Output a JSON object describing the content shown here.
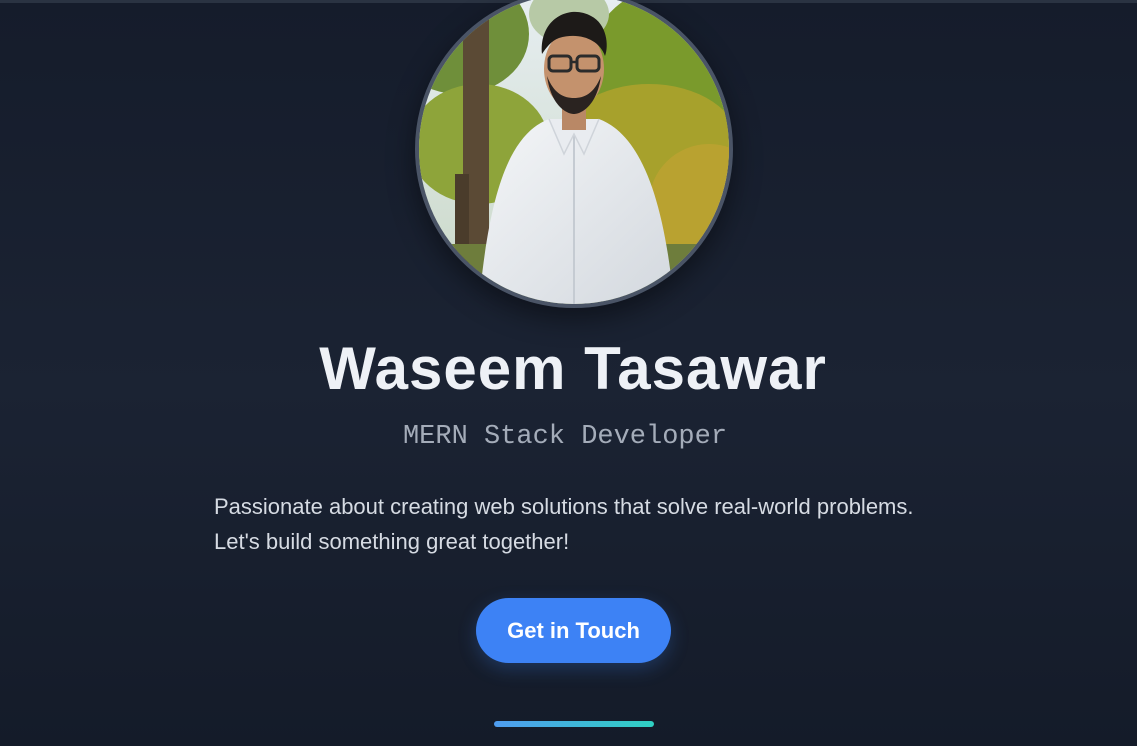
{
  "profile": {
    "name": "Waseem Tasawar",
    "role": "MERN Stack Developer",
    "description_line1": "Passionate about creating web solutions that solve real-world problems.",
    "description_line2": "Let's build something great together!",
    "avatar_alt": "Waseem Tasawar"
  },
  "cta": {
    "label": "Get in Touch"
  },
  "theme": {
    "background": "#1b2333",
    "accent": "#3d82f5",
    "indicator_start": "#4f9cf0",
    "indicator_end": "#2fd0c2"
  }
}
